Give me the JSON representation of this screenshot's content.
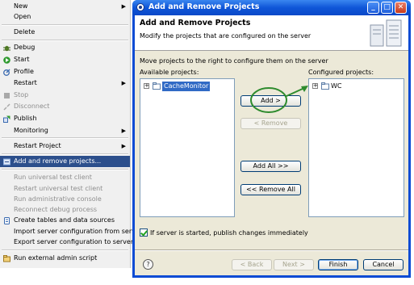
{
  "context_menu": {
    "items": [
      {
        "label": "New",
        "has_submenu": true,
        "disabled": false,
        "icon": ""
      },
      {
        "label": "Open",
        "has_submenu": false,
        "disabled": false,
        "icon": ""
      },
      {
        "label": "Delete",
        "has_submenu": false,
        "disabled": false,
        "icon": ""
      },
      {
        "label": "Debug",
        "has_submenu": false,
        "disabled": false,
        "icon": "debug-bug-icon"
      },
      {
        "label": "Start",
        "has_submenu": false,
        "disabled": false,
        "icon": "start-run-icon"
      },
      {
        "label": "Profile",
        "has_submenu": false,
        "disabled": false,
        "icon": "profile-icon"
      },
      {
        "label": "Restart",
        "has_submenu": true,
        "disabled": false,
        "icon": ""
      },
      {
        "label": "Stop",
        "has_submenu": false,
        "disabled": true,
        "icon": "stop-icon"
      },
      {
        "label": "Disconnect",
        "has_submenu": false,
        "disabled": true,
        "icon": "disconnect-icon"
      },
      {
        "label": "Publish",
        "has_submenu": false,
        "disabled": false,
        "icon": "publish-icon"
      },
      {
        "label": "Monitoring",
        "has_submenu": true,
        "disabled": false,
        "icon": ""
      },
      {
        "label": "Restart Project",
        "has_submenu": true,
        "disabled": false,
        "icon": ""
      },
      {
        "label": "Add and remove projects...",
        "has_submenu": false,
        "disabled": false,
        "selected": true,
        "icon": "add-remove-projects-icon"
      },
      {
        "label": "Run universal test client",
        "has_submenu": false,
        "disabled": true,
        "icon": ""
      },
      {
        "label": "Restart universal test client",
        "has_submenu": false,
        "disabled": true,
        "icon": ""
      },
      {
        "label": "Run administrative console",
        "has_submenu": false,
        "disabled": true,
        "icon": ""
      },
      {
        "label": "Reconnect debug process",
        "has_submenu": false,
        "disabled": true,
        "icon": ""
      },
      {
        "label": "Create tables and data sources",
        "has_submenu": false,
        "disabled": false,
        "icon": "database-icon"
      },
      {
        "label": "Import server configuration from server",
        "has_submenu": false,
        "disabled": false,
        "icon": ""
      },
      {
        "label": "Export server configuration to server",
        "has_submenu": false,
        "disabled": false,
        "icon": ""
      },
      {
        "label": "Run external admin script",
        "has_submenu": false,
        "disabled": false,
        "icon": "admin-script-icon"
      }
    ]
  },
  "dialog": {
    "title": "Add and Remove Projects",
    "header_title": "Add and Remove Projects",
    "header_subtitle": "Modify the projects that are configured on the server",
    "instruction": "Move projects to the right to configure them on the server",
    "available_label": "Available projects:",
    "configured_label": "Configured projects:",
    "available_projects": [
      "CacheMonitor"
    ],
    "configured_projects": [
      "WC"
    ],
    "buttons": {
      "add": "Add >",
      "remove": "< Remove",
      "add_all": "Add All >>",
      "remove_all": "<< Remove All",
      "back": "< Back",
      "next": "Next >",
      "finish": "Finish",
      "cancel": "Cancel"
    },
    "publish_checkbox_label": "If server is started, publish changes immediately",
    "publish_checked": true,
    "title_buttons": {
      "minimize": "_",
      "maximize": "□",
      "close": "✕"
    },
    "help_label": "?",
    "colors": {
      "title_blue": "#0a4bd4",
      "selection": "#316ac5",
      "highlight_circle": "#2e8b2e"
    }
  }
}
